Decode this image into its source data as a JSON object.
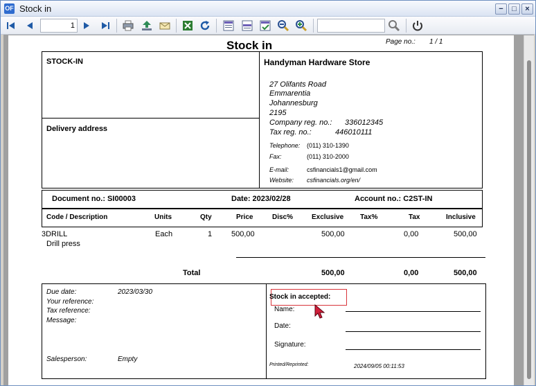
{
  "window": {
    "title": "Stock in",
    "app_icon": "OF"
  },
  "toolbar": {
    "page_number": "1",
    "search_value": ""
  },
  "report": {
    "title": "Stock in",
    "page_label": "Page no.:",
    "page_value": "1  /  1",
    "doc_type": "STOCK-IN",
    "delivery_label": "Delivery address",
    "company": {
      "name": "Handyman Hardware Store",
      "address1": "27 Olifants Road",
      "address2": "Emmarentia",
      "address3": "Johannesburg",
      "postcode": "2195",
      "company_reg_label": "Company reg. no.:",
      "company_reg_value": "336012345",
      "tax_reg_label": "Tax reg. no.:",
      "tax_reg_value": "446010111",
      "telephone_label": "Telephone:",
      "telephone_value": "(011) 310-1390",
      "fax_label": "Fax:",
      "fax_value": "(011) 310-2000",
      "email_label": "E-mail:",
      "email_value": "csfinancials1@gmail.com",
      "website_label": "Website:",
      "website_value": "csfinancials.org/en/"
    },
    "document_label": "Document no.: SI00003",
    "date_label": "Date: 2023/02/28",
    "account_label": "Account no.: C2ST-IN",
    "columns": {
      "code": "Code / Description",
      "units": "Units",
      "qty": "Qty",
      "price": "Price",
      "disc": "Disc%",
      "exclusive": "Exclusive",
      "tax_pct": "Tax%",
      "tax": "Tax",
      "inclusive": "Inclusive"
    },
    "lines": [
      {
        "code": "3DRILL",
        "description": "Drill press",
        "units": "Each",
        "qty": "1",
        "price": "500,00",
        "disc": "",
        "exclusive": "500,00",
        "tax_pct": "",
        "tax": "0,00",
        "inclusive": "500,00"
      }
    ],
    "totals": {
      "label": "Total",
      "exclusive": "500,00",
      "tax": "0,00",
      "inclusive": "500,00"
    },
    "footer": {
      "due_date_label": "Due date:",
      "due_date_value": "2023/03/30",
      "your_reference_label": "Your reference:",
      "tax_reference_label": "Tax reference:",
      "message_label": "Message:",
      "salesperson_label": "Salesperson:",
      "salesperson_value": "Empty",
      "accepted_label": "Stock in  accepted:",
      "name_label": "Name:",
      "date_label": "Date:",
      "signature_label": "Signature:",
      "printed_label": "Printed/Reprinted:",
      "printed_value": "2024/09/05 00:11:53"
    }
  }
}
